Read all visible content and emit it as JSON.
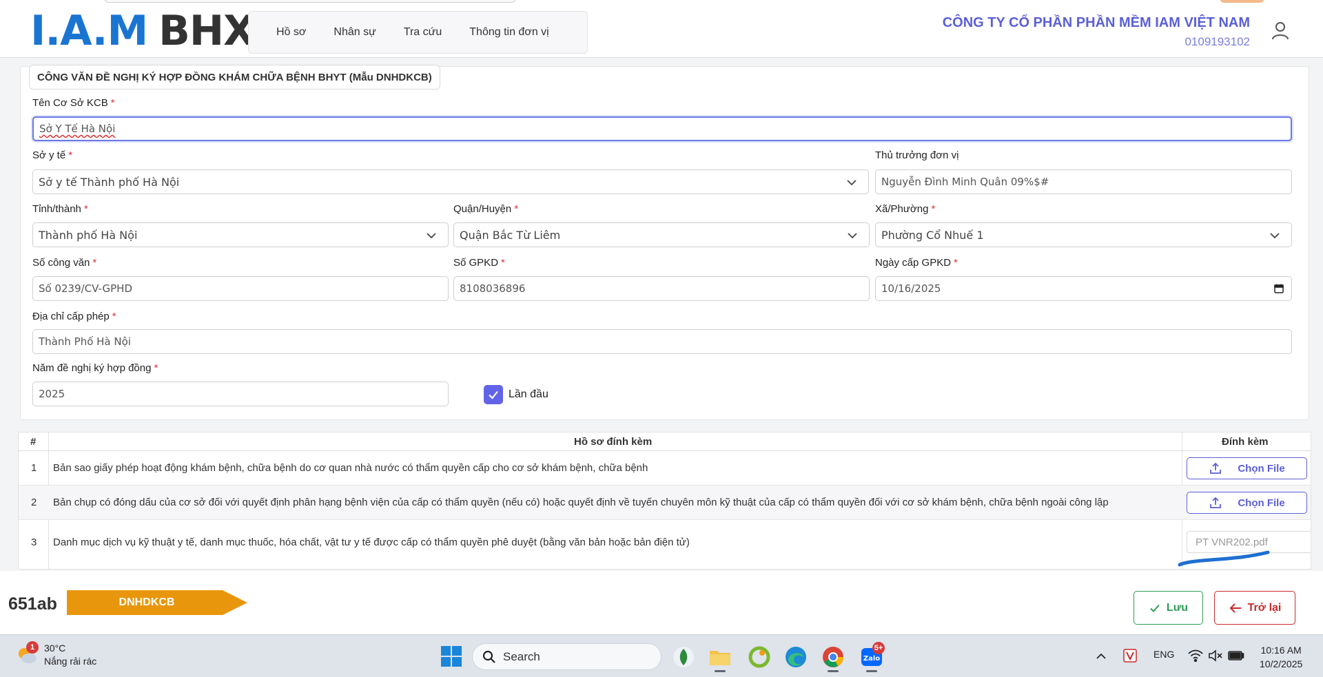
{
  "header": {
    "logo_iam": "I.A.M",
    "logo_bhxh": "BHXH",
    "nav": [
      "Hồ sơ",
      "Nhân sự",
      "Tra cứu",
      "Thông tin đơn vị"
    ],
    "company_name": "CÔNG TY CỔ PHẦN PHẦN MỀM IAM VIỆT NAM",
    "company_code": "0109193102"
  },
  "form": {
    "title": "CÔNG VĂN ĐỀ NGHỊ KÝ HỢP ĐỒNG KHÁM CHỮA BỆNH BHYT (Mẫu DNHDKCB)",
    "required_mark": "*",
    "ten_co_so": {
      "label": "Tên Cơ Sở KCB",
      "value": "Sở Y Tế Hà Nội"
    },
    "so_y_te": {
      "label": "Sở y tế",
      "value": "Sở y tế Thành phố Hà Nội"
    },
    "thu_truong": {
      "label": "Thủ trưởng đơn vị",
      "value": "Nguyễn Đình Minh Quân 09%$#"
    },
    "tinh_thanh": {
      "label": "Tỉnh/thành",
      "value": "Thành phố Hà Nội"
    },
    "quan_huyen": {
      "label": "Quận/Huyện",
      "value": "Quận Bắc Từ Liêm"
    },
    "xa_phuong": {
      "label": "Xã/Phường",
      "value": "Phường Cổ Nhuế 1"
    },
    "so_cong_van": {
      "label": "Số công văn",
      "value": "Số 0239/CV-GPHD"
    },
    "so_gpkd": {
      "label": "Số GPKD",
      "value": "8108036896"
    },
    "ngay_cap": {
      "label": "Ngày cấp GPKD",
      "value": "10/16/2025"
    },
    "dia_chi": {
      "label": "Địa chỉ cấp phép",
      "value": "Thành Phố Hà Nội"
    },
    "nam_de_nghi": {
      "label": "Năm đề nghị ký hợp đồng",
      "value": "2025"
    },
    "lan_dau": {
      "label": "Lần đầu",
      "checked": true
    }
  },
  "attachments": {
    "headers": [
      "#",
      "Hồ sơ đính kèm",
      "Đính kèm"
    ],
    "choose_file": "Chọn File",
    "rows": [
      {
        "num": "1",
        "text": "Bản sao giấy phép hoạt động khám bệnh, chữa bệnh do cơ quan nhà nước có thẩm quyền cấp cho cơ sở khám bệnh, chữa bệnh",
        "file": ""
      },
      {
        "num": "2",
        "text": "Bản chụp có đóng dấu của cơ sở đối với quyết định phân hạng bệnh viện của cấp có thẩm quyền (nếu có) hoặc quyết định về tuyến chuyên môn kỹ thuật của cấp có thẩm quyền đối với cơ sở khám bệnh, chữa bệnh ngoài công lập",
        "file": ""
      },
      {
        "num": "3",
        "text": "Danh mục dịch vụ kỹ thuật y tế, danh mục thuốc, hóa chất, vật tư y tế được cấp có thẩm quyền phê duyệt (bằng văn bản hoặc bản điện tử)",
        "file": "PT VNR202.pdf"
      }
    ]
  },
  "footer": {
    "code": "651ab",
    "tag": "DNHDKCB",
    "save": "Lưu",
    "back": "Trở lại"
  },
  "taskbar": {
    "weather_badge": "1",
    "temperature": "30°C",
    "weather_desc": "Nắng rải rác",
    "search_placeholder": "Search",
    "zalo_badge": "5+",
    "lang": "ENG",
    "time": "10:16 AM",
    "date": "10/2/2025"
  },
  "colors": {
    "accent": "#5b5fd6",
    "logo_blue": "#1a75d2",
    "tag_orange": "#e8960c",
    "save_green": "#2e9b54",
    "back_red": "#c92a2a"
  }
}
